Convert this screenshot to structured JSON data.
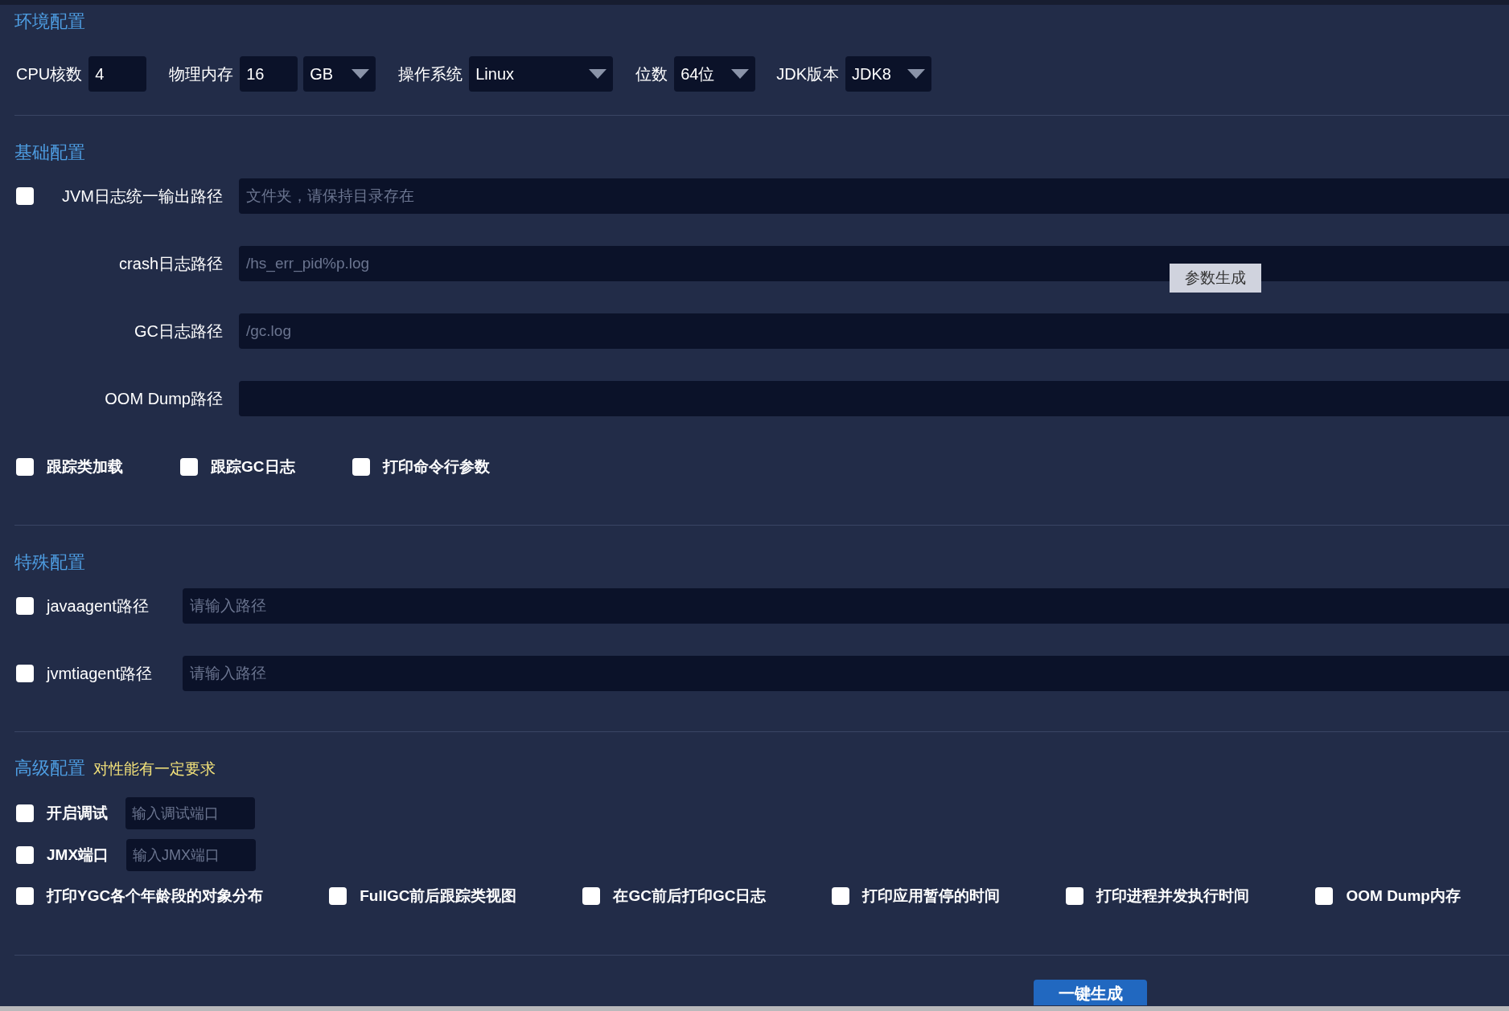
{
  "env": {
    "title": "环境配置",
    "fields": [
      {
        "kind": "input",
        "label": "CPU核数",
        "value": "4"
      },
      {
        "kind": "input",
        "label": "物理内存",
        "value": "16"
      },
      {
        "kind": "select",
        "value": "GB"
      },
      {
        "kind": "select",
        "label": "操作系统",
        "value": "Linux"
      },
      {
        "kind": "select",
        "label": "位数",
        "value": "64位"
      },
      {
        "kind": "select",
        "label": "JDK版本",
        "value": "JDK8"
      }
    ]
  },
  "basic": {
    "title": "基础配置",
    "paths": [
      {
        "kind": "checkbox",
        "label": "JVM日志统一输出路径",
        "checked": false,
        "placeholder": "文件夹，请保持目录存在"
      },
      {
        "kind": "plain",
        "label": "crash日志路径",
        "placeholder": "/hs_err_pid%p.log"
      },
      {
        "kind": "plain",
        "label": "GC日志路径",
        "placeholder": "/gc.log"
      },
      {
        "kind": "plain",
        "label": "OOM Dump路径"
      }
    ],
    "options": [
      {
        "label": "跟踪类加载",
        "checked": false
      },
      {
        "label": "跟踪GC日志",
        "checked": false
      },
      {
        "label": "打印命令行参数",
        "checked": false
      }
    ]
  },
  "generate_params_button": "参数生成",
  "special": {
    "title": "特殊配置",
    "paths": [
      {
        "kind": "checkbox",
        "label": "javaagent路径",
        "checked": false,
        "placeholder": "请输入路径"
      },
      {
        "kind": "checkbox",
        "label": "jvmtiagent路径",
        "checked": false,
        "placeholder": "请输入路径"
      }
    ]
  },
  "advanced": {
    "title": "高级配置",
    "note": "对性能有一定要求",
    "ports": [
      {
        "label": "开启调试",
        "checked": false,
        "placeholder": "输入调试端口"
      },
      {
        "label": "JMX端口",
        "checked": false,
        "placeholder": "输入JMX端口"
      }
    ],
    "options": [
      {
        "label": "打印YGC各个年龄段的对象分布",
        "checked": false
      },
      {
        "label": "FullGC前后跟踪类视图",
        "checked": false
      },
      {
        "label": "在GC前后打印GC日志",
        "checked": false
      },
      {
        "label": "打印应用暂停的时间",
        "checked": false
      },
      {
        "label": "打印进程并发执行时间",
        "checked": false
      },
      {
        "label": "OOM Dump内存",
        "checked": false
      }
    ]
  },
  "generate_button": "一键生成"
}
